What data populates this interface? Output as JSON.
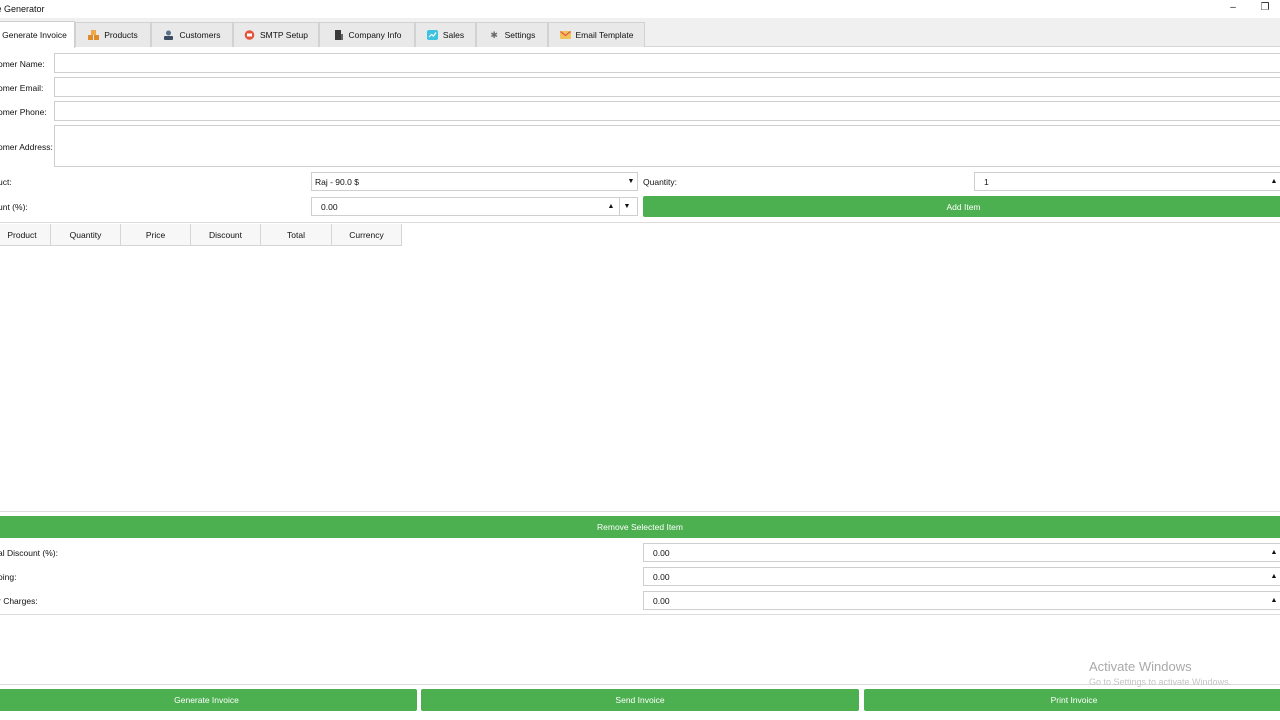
{
  "window": {
    "title": "ce Generator",
    "minimize": "–",
    "restore": "❐"
  },
  "tabs": [
    {
      "label": "Generate Invoice",
      "icon": "",
      "active": true
    },
    {
      "label": "Products",
      "icon": "boxes-icon"
    },
    {
      "label": "Customers",
      "icon": "customers-icon"
    },
    {
      "label": "SMTP Setup",
      "icon": "smtp-icon"
    },
    {
      "label": "Company Info",
      "icon": "building-icon"
    },
    {
      "label": "Sales",
      "icon": "sales-icon"
    },
    {
      "label": "Settings",
      "icon": "gear-icon"
    },
    {
      "label": "Email Template",
      "icon": "email-template-icon"
    }
  ],
  "form": {
    "customer_name_label": "omer Name:",
    "customer_name_value": "",
    "customer_email_label": "omer Email:",
    "customer_email_value": "",
    "customer_phone_label": "omer Phone:",
    "customer_phone_value": "",
    "customer_address_label": "omer Address:",
    "customer_address_value": "",
    "product_label": "uct:",
    "product_value": "Raj - 90.0 $",
    "quantity_label": "Quantity:",
    "quantity_value": "1",
    "discount_label": "unt (%):",
    "discount_value": "0.00",
    "add_item_label": "Add Item"
  },
  "table": {
    "columns": [
      "Product",
      "Quantity",
      "Price",
      "Discount",
      "Total",
      "Currency"
    ],
    "rows": []
  },
  "remove_selected_label": "Remove Selected Item",
  "totals": {
    "total_discount_label": "al Discount (%):",
    "total_discount_value": "0.00",
    "shipping_label": "oing:",
    "shipping_value": "0.00",
    "other_charges_label": "r Charges:",
    "other_charges_value": "0.00"
  },
  "actions": {
    "generate_label": "Generate Invoice",
    "send_label": "Send Invoice",
    "print_label": "Print Invoice"
  },
  "watermark": {
    "line1": "Activate Windows",
    "line2": "Go to Settings to activate Windows."
  },
  "colors": {
    "green": "#4caf50"
  }
}
